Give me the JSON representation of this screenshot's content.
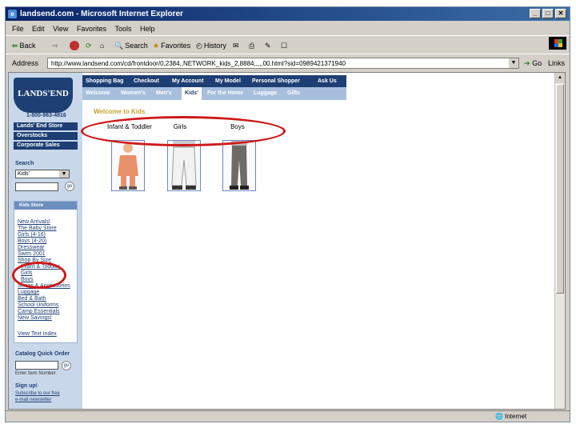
{
  "window": {
    "title": "landsend.com - Microsoft Internet Explorer"
  },
  "menu": [
    "File",
    "Edit",
    "View",
    "Favorites",
    "Tools",
    "Help"
  ],
  "toolbar": {
    "back": "Back",
    "search": "Search",
    "favorites": "Favorites",
    "history": "History"
  },
  "address": {
    "label": "Address",
    "url": "http://www.landsend.com/cd/frontdoor/0,2384,,NETWORK_kids_2,8884,,,,,00.html?sid=0989421371940",
    "go": "Go",
    "links": "Links"
  },
  "site": {
    "logo": "LANDS'END",
    "phone": "1-800-963-4816",
    "side_buttons": [
      "Lands' End Store",
      "Overstocks",
      "Corporate Sales"
    ],
    "search": {
      "label": "Search",
      "value": "Kids'"
    },
    "kids_store": {
      "title": "Kids Store",
      "links": [
        "New Arrivals!",
        "The Baby Store",
        "Girls (4-16)",
        "Boys (4-20)",
        "Dresswear",
        "Swim 2001",
        "Shop By Size",
        "Infant & Toddler",
        "Girls",
        "Boys",
        "Shoes & Accessories",
        "Luggage",
        "Bed & Bath",
        "School Uniforms",
        "Camp Essentials",
        "New Savings!"
      ],
      "index": "View Text Index"
    },
    "quick_order": {
      "label": "Catalog Quick Order",
      "hint": "Enter Item Number"
    },
    "signup": {
      "label": "Sign up!",
      "line1": "Subscribe to our free",
      "line2": "e-mail newsletter"
    },
    "topnav": [
      "Shopping Bag",
      "Checkout",
      "My Account",
      "My Model",
      "Personal Shopper",
      "Ask Us"
    ],
    "subnav": [
      "Welcome",
      "Women's",
      "Men's",
      "Kids'",
      "For the Home",
      "Luggage",
      "Gifts"
    ],
    "welcome": "Welcome to Kids",
    "categories": [
      "Infant & Toddler",
      "Girls",
      "Boys"
    ]
  },
  "status": {
    "zone": "Internet"
  }
}
